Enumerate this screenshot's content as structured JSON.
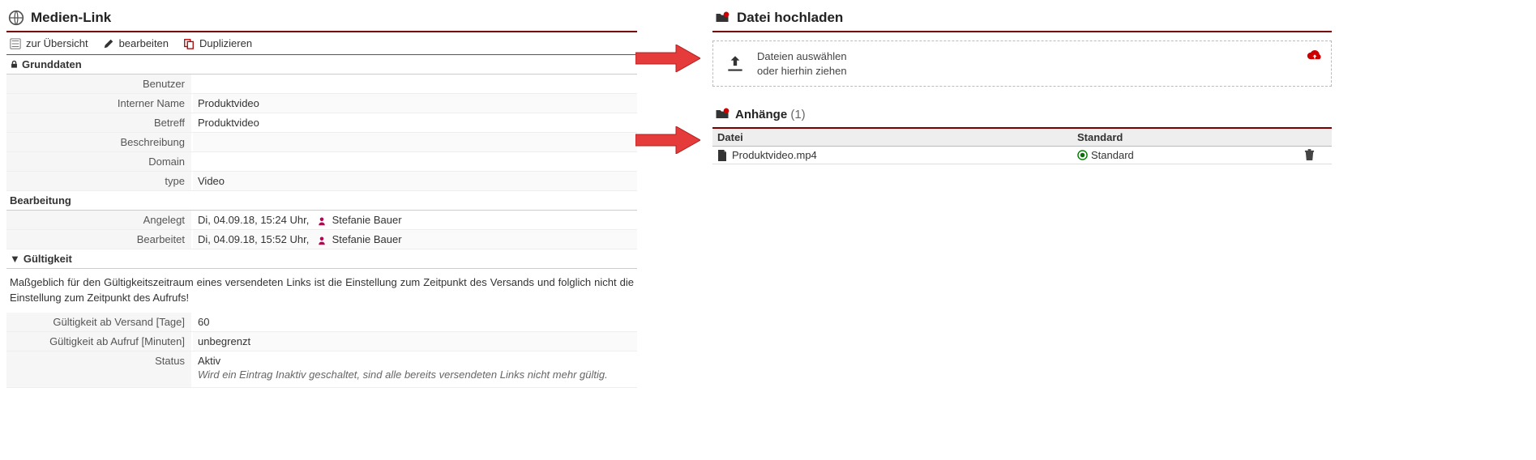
{
  "left": {
    "title": "Medien-Link",
    "toolbar": {
      "overview": "zur Übersicht",
      "edit": "bearbeiten",
      "duplicate": "Duplizieren"
    },
    "sections": {
      "grunddaten": {
        "header": "Grunddaten",
        "rows": {
          "benutzer_label": "Benutzer",
          "benutzer_value": "",
          "interner_name_label": "Interner Name",
          "interner_name_value": "Produktvideo",
          "betreff_label": "Betreff",
          "betreff_value": "Produktvideo",
          "beschreibung_label": "Beschreibung",
          "beschreibung_value": "",
          "domain_label": "Domain",
          "domain_value": "",
          "type_label": "type",
          "type_value": "Video"
        }
      },
      "bearbeitung": {
        "header": "Bearbeitung",
        "angelegt_label": "Angelegt",
        "angelegt_value": "Di, 04.09.18, 15:24 Uhr,",
        "angelegt_user": "Stefanie Bauer",
        "bearbeitet_label": "Bearbeitet",
        "bearbeitet_value": "Di, 04.09.18, 15:52 Uhr,",
        "bearbeitet_user": "Stefanie Bauer"
      },
      "gueltigkeit": {
        "header": "Gültigkeit",
        "info": "Maßgeblich für den Gültigkeitszeitraum eines versendeten Links ist die Einstellung zum Zeitpunkt des Versands und folglich nicht die Einstellung zum Zeitpunkt des Aufrufs!",
        "versand_label": "Gültigkeit ab Versand [Tage]",
        "versand_value": "60",
        "aufruf_label": "Gültigkeit ab Aufruf [Minuten]",
        "aufruf_value": "unbegrenzt",
        "status_label": "Status",
        "status_value": "Aktiv",
        "status_note": "Wird ein Eintrag Inaktiv geschaltet, sind alle bereits versendeten Links nicht mehr gültig."
      }
    }
  },
  "right": {
    "upload_title": "Datei hochladen",
    "upload_line1": "Dateien auswählen",
    "upload_line2": "oder hierhin ziehen",
    "attach_title": "Anhänge",
    "attach_count": "(1)",
    "table": {
      "col_file": "Datei",
      "col_standard": "Standard",
      "row": {
        "filename": "Produktvideo.mp4",
        "standard": "Standard"
      }
    }
  }
}
